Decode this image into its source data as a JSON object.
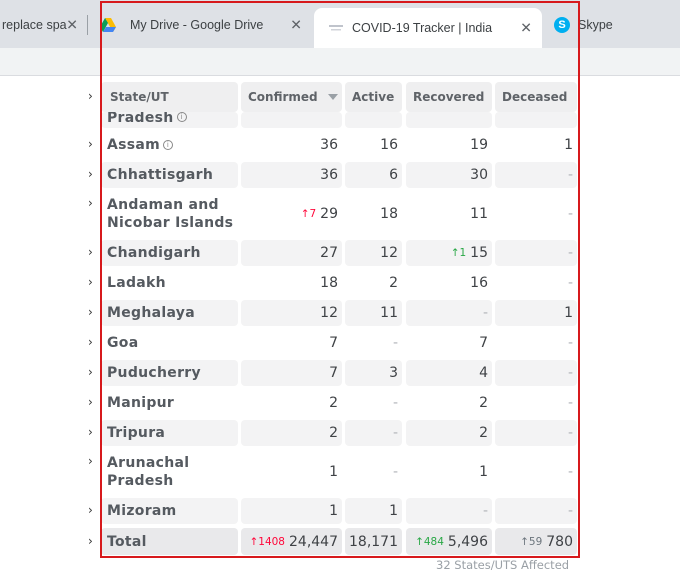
{
  "browser": {
    "tabs": [
      {
        "title": "replace spa",
        "icon": "none"
      },
      {
        "title": "My Drive - Google Drive",
        "icon": "google-drive-icon"
      },
      {
        "title": "COVID-19 Tracker | India",
        "icon": "covid-tracker-icon",
        "active": true
      },
      {
        "title": "Skype",
        "icon": "skype-icon"
      }
    ]
  },
  "table": {
    "headers": {
      "state": "State/UT",
      "confirmed": "Confirmed",
      "active": "Active",
      "recovered": "Recovered",
      "deceased": "Deceased"
    },
    "partial_row": {
      "state": "Pradesh"
    },
    "rows": [
      {
        "state": "Assam",
        "info": true,
        "confirmed": "36",
        "confirmed_delta": "",
        "active": "16",
        "recovered": "19",
        "recovered_delta": "",
        "deceased": "1"
      },
      {
        "state": "Chhattisgarh",
        "confirmed": "36",
        "confirmed_delta": "",
        "active": "6",
        "recovered": "30",
        "recovered_delta": "",
        "deceased": "-"
      },
      {
        "state": "Andaman and Nicobar Islands",
        "confirmed": "29",
        "confirmed_delta": "↑7",
        "active": "18",
        "recovered": "11",
        "recovered_delta": "",
        "deceased": "-"
      },
      {
        "state": "Chandigarh",
        "confirmed": "27",
        "confirmed_delta": "",
        "active": "12",
        "recovered": "15",
        "recovered_delta": "↑1",
        "deceased": "-"
      },
      {
        "state": "Ladakh",
        "confirmed": "18",
        "confirmed_delta": "",
        "active": "2",
        "recovered": "16",
        "recovered_delta": "",
        "deceased": "-"
      },
      {
        "state": "Meghalaya",
        "confirmed": "12",
        "confirmed_delta": "",
        "active": "11",
        "recovered": "-",
        "recovered_delta": "",
        "deceased": "1"
      },
      {
        "state": "Goa",
        "confirmed": "7",
        "confirmed_delta": "",
        "active": "-",
        "recovered": "7",
        "recovered_delta": "",
        "deceased": "-"
      },
      {
        "state": "Puducherry",
        "confirmed": "7",
        "confirmed_delta": "",
        "active": "3",
        "recovered": "4",
        "recovered_delta": "",
        "deceased": "-"
      },
      {
        "state": "Manipur",
        "confirmed": "2",
        "confirmed_delta": "",
        "active": "-",
        "recovered": "2",
        "recovered_delta": "",
        "deceased": "-"
      },
      {
        "state": "Tripura",
        "confirmed": "2",
        "confirmed_delta": "",
        "active": "-",
        "recovered": "2",
        "recovered_delta": "",
        "deceased": "-"
      },
      {
        "state": "Arunachal Pradesh",
        "confirmed": "1",
        "confirmed_delta": "",
        "active": "-",
        "recovered": "1",
        "recovered_delta": "",
        "deceased": "-"
      },
      {
        "state": "Mizoram",
        "confirmed": "1",
        "confirmed_delta": "",
        "active": "1",
        "recovered": "-",
        "recovered_delta": "",
        "deceased": "-"
      }
    ],
    "total": {
      "state": "Total",
      "confirmed": "24,447",
      "confirmed_delta": "↑1408",
      "active": "18,171",
      "recovered": "5,496",
      "recovered_delta": "↑484",
      "deceased": "780",
      "deceased_delta": "↑59"
    },
    "footer_note": "32 States/UTS Affected"
  },
  "colors": {
    "highlight_border": "#d7191c",
    "delta_red": "#ff073a",
    "delta_green": "#28a745",
    "delta_grey": "#6c757d"
  }
}
